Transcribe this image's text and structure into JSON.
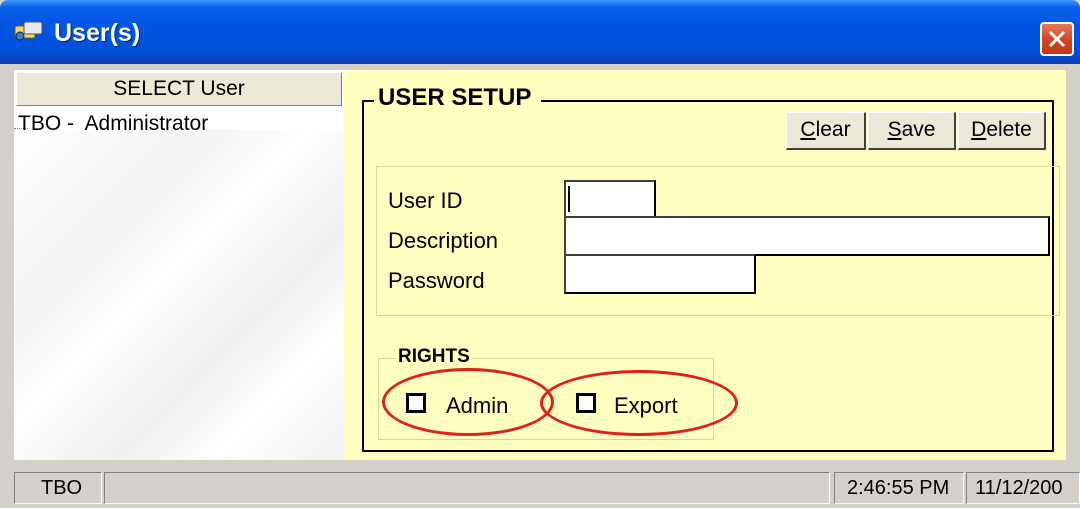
{
  "window": {
    "title": "User(s)"
  },
  "left_panel": {
    "header": "SELECT User",
    "users": [
      {
        "code": "TBO -",
        "name": "Administrator"
      }
    ]
  },
  "setup": {
    "title": "USER SETUP",
    "buttons": {
      "clear": {
        "accel": "C",
        "rest": "lear"
      },
      "save": {
        "accel": "S",
        "rest": "ave"
      },
      "delete": {
        "accel": "D",
        "rest": "elete"
      }
    },
    "fields": {
      "user_id": {
        "label": "User ID",
        "value": ""
      },
      "description": {
        "label": "Description",
        "value": ""
      },
      "password": {
        "label": "Password",
        "value": ""
      }
    },
    "rights": {
      "title": "RIGHTS",
      "admin": {
        "label": "Admin",
        "checked": false
      },
      "export": {
        "label": "Export",
        "checked": false
      }
    },
    "annotation_color": "#e0201a"
  },
  "statusbar": {
    "user": "TBO",
    "time": "2:46:55 PM",
    "date": "11/12/200"
  },
  "colors": {
    "titlebar": "#0054e3",
    "panel_bg": "#ffffc0",
    "close_button": "#d3421f"
  }
}
